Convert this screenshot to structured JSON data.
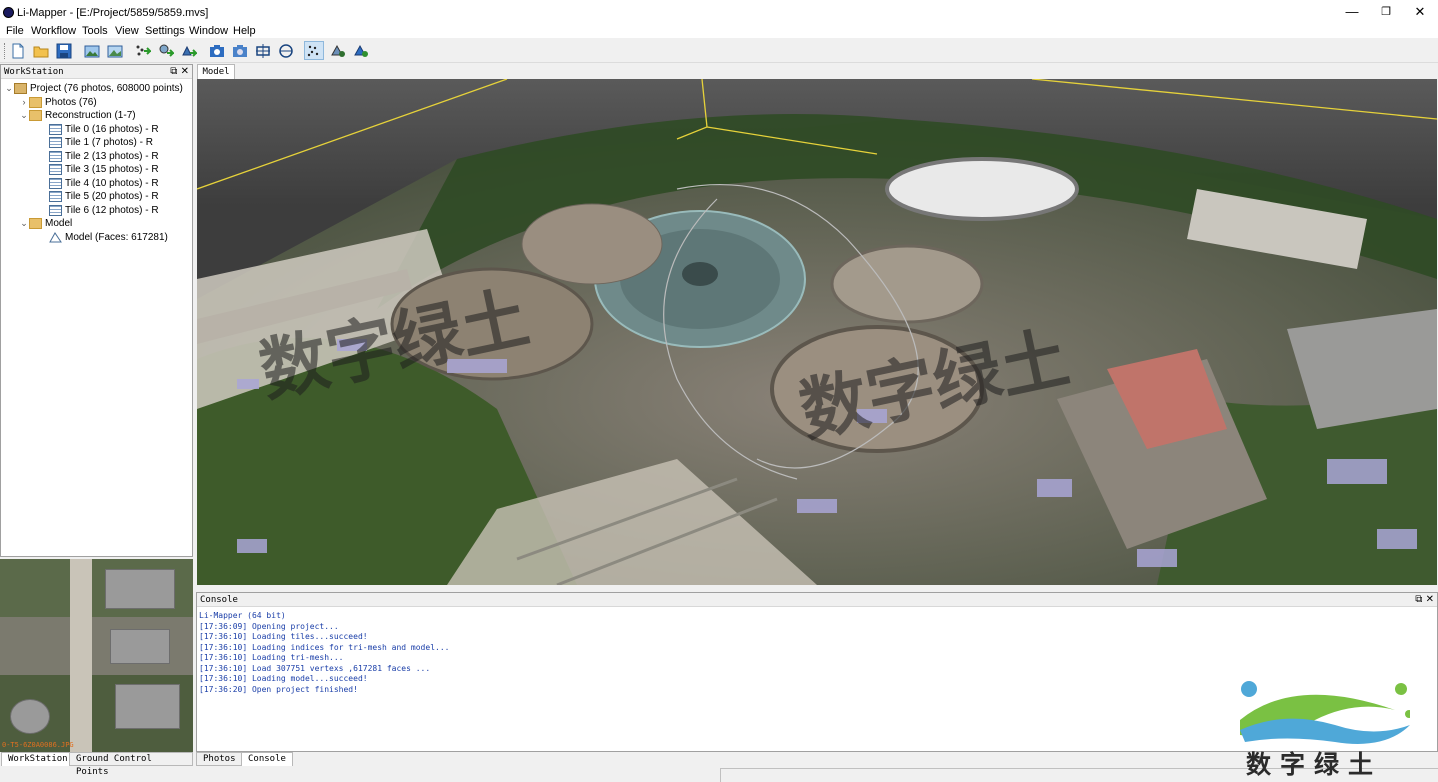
{
  "window": {
    "title": "Li-Mapper - [E:/Project/5859/5859.mvs]",
    "minimize": "—",
    "restore": "❐",
    "close": "✕"
  },
  "menu": [
    "File",
    "Workflow",
    "Tools",
    "View",
    "Settings",
    "Window",
    "Help"
  ],
  "toolbar": {
    "icons": [
      "new-project-icon",
      "open-project-icon",
      "save-icon",
      "add-photos-icon",
      "add-image-folder-icon",
      "align-icon",
      "densify-icon",
      "mesh-icon",
      "camera-view-icon",
      "camera-settings-icon",
      "fit-view-icon",
      "rotate-view-icon",
      "point-cloud-icon",
      "texture-icon",
      "model-icon"
    ],
    "active_index": 12
  },
  "workstation": {
    "header": "WorkStation",
    "header_buttons": "⧉ ✕",
    "project": "Project (76 photos, 608000 points)",
    "photos": "Photos (76)",
    "reconstruction": "Reconstruction (1-7)",
    "tiles": [
      "Tile 0 (16 photos) - R",
      "Tile 1 (7 photos) - R",
      "Tile 2 (13 photos) - R",
      "Tile 3 (15 photos) - R",
      "Tile 4 (10 photos) - R",
      "Tile 5 (20 photos) - R",
      "Tile 6 (12 photos) - R"
    ],
    "model_folder": "Model",
    "model_item": "Model (Faces: 617281)"
  },
  "thumbnail_label": "0-T5-6Z0A0086.JPG",
  "left_tabs": [
    "WorkStation",
    "Ground Control Points"
  ],
  "model_tab": "Model",
  "console": {
    "header": "Console",
    "header_buttons": "⧉ ✕",
    "lines": [
      "Li-Mapper (64 bit)",
      "[17:36:09] Opening project...",
      "[17:36:10] Loading tiles...succeed!",
      "[17:36:10] Loading indices for tri-mesh and model...",
      "[17:36:10] Loading tri-mesh...",
      "[17:36:10] Load 307751 vertexs ,617281 faces ...",
      "[17:36:10] Loading model...succeed!",
      "[17:36:20] Open project finished!"
    ]
  },
  "bottom_tabs": [
    "Photos",
    "Console"
  ],
  "watermark": {
    "text": "数字绿土",
    "overlay_1": "数字绿土",
    "overlay_2": "数字绿土"
  },
  "colors": {
    "bbox_line": "#e6d23a",
    "console_text": "#1a3ea8",
    "thumb_label": "#e07020"
  }
}
